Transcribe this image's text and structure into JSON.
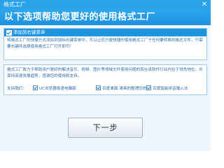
{
  "window": {
    "title": "格式工厂"
  },
  "header": {
    "headline": "以下选项帮助您更好的使用格式工厂"
  },
  "context_menu_panel": {
    "label": "添加到右键菜单",
    "description": "将格式工厂的快捷方式添加到鼠标右键菜单中，可以让您方便快捷的使用格式工厂于任何要转换的格式文件，只需要右键并选择使用格式工厂打开即可！"
  },
  "support_panel": {
    "description": "格式工厂致力于帮助用户更好的解决音乐、视频、图片等领域文件使用问题的现在该软件行业内位于领先地位，并保持高速发展趋势，感谢您的使用和支持。",
    "support_label": "支持我们：",
    "options": [
      {
        "label": "UC浏览器极速电脑版",
        "checked": true
      },
      {
        "label": "百度桌面-清爽的整理您的",
        "checked": true
      },
      {
        "label": "百度智能拼音输入法",
        "checked": true
      }
    ]
  },
  "footer": {
    "next_label": "下一步"
  },
  "colors": {
    "accent": "#1e95e0",
    "title_bar": "#2aa2ea",
    "text": "#2d6aa6"
  }
}
